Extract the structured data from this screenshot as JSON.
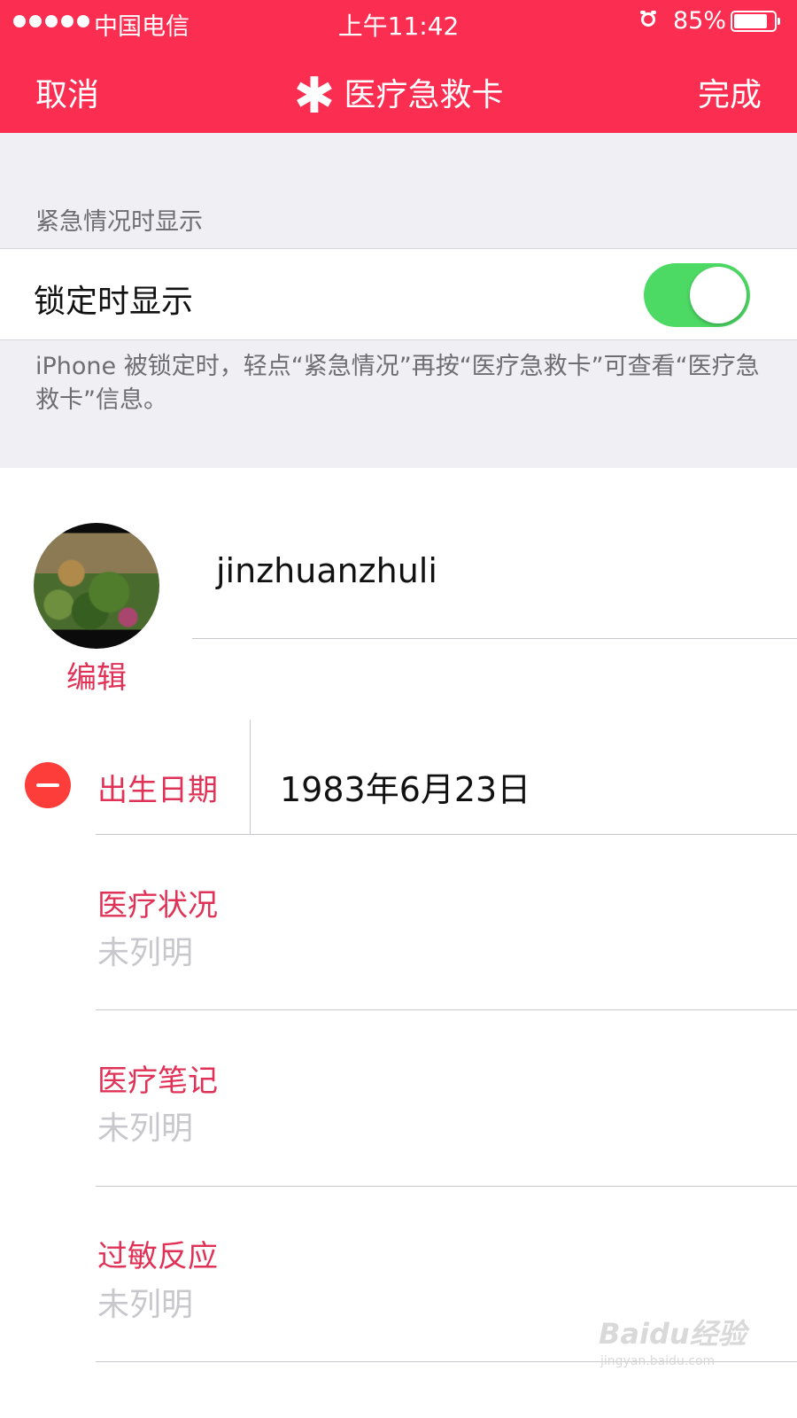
{
  "status_bar": {
    "carrier": "中国电信",
    "time": "上午11:42",
    "battery_percent_label": "85%",
    "battery_level": 0.85,
    "icons": [
      "signal-dots",
      "alarm-icon",
      "battery-icon"
    ]
  },
  "nav": {
    "cancel_label": "取消",
    "title": "医疗急救卡",
    "title_icon": "✱",
    "done_label": "完成"
  },
  "emergency_section": {
    "header": "紧急情况时显示",
    "show_when_locked_label": "锁定时显示",
    "show_when_locked_on": true,
    "footer": "iPhone 被锁定时，轻点“紧急情况”再按“医疗急救卡”可查看“医疗急救卡”信息。"
  },
  "profile": {
    "name": "jinzhuanzhuli",
    "edit_label": "编辑"
  },
  "fields": {
    "birth_date": {
      "label": "出生日期",
      "value": "1983年6月23日"
    },
    "medical_conditions": {
      "label": "医疗状况",
      "placeholder": "未列明"
    },
    "medical_notes": {
      "label": "医疗笔记",
      "placeholder": "未列明"
    },
    "allergies": {
      "label": "过敏反应",
      "placeholder": "未列明"
    }
  },
  "watermark": {
    "brand": "Baidu经验",
    "url": "jingyan.baidu.com"
  },
  "colors": {
    "nav_background": "#fb2e51",
    "accent_text": "#e03257",
    "toggle_on": "#4cd964",
    "delete_red": "#fc3d39",
    "grouped_background": "#efeff4",
    "placeholder_gray": "#c7c7cc"
  }
}
